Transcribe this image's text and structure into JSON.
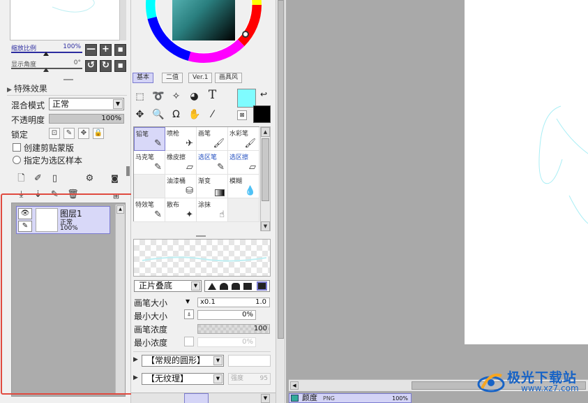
{
  "navigator": {
    "zoom_label": "缩放比例",
    "zoom_value": "100%",
    "rotate_label": "显示角度",
    "rotate_value": "0°",
    "zoom_out": "—",
    "zoom_in": "+",
    "zoom_reset": "■",
    "rotate_left": "↺",
    "rotate_right": "↻",
    "rotate_reset": "■"
  },
  "effects": {
    "header": "特殊效果"
  },
  "layer_props": {
    "blend_label": "混合模式",
    "blend_value": "正常",
    "opacity_label": "不透明度",
    "opacity_value": "100%",
    "lock_label": "锁定",
    "clip_label": "创建剪贴蒙版",
    "select_source_label": "指定为选区样本"
  },
  "layers": [
    {
      "name": "图层1",
      "mode": "正常",
      "opacity": "100%"
    }
  ],
  "color_tabs": [
    "基本",
    "二值",
    "Ver.1",
    "画具风"
  ],
  "colors": {
    "main": "#7ffcff",
    "sub": "#000000",
    "highlight": "#e04a3f"
  },
  "tools_icons": [
    "select-rect-icon",
    "lasso-icon",
    "magic-wand-icon",
    "select-pen-icon",
    "text-icon",
    "move-icon",
    "zoom-icon",
    "rotate-icon",
    "hand-icon",
    "eyedropper-icon"
  ],
  "brushes": [
    {
      "name": "铅笔",
      "icon": "✎",
      "selected": true,
      "blue": false
    },
    {
      "name": "喷枪",
      "icon": "✈",
      "selected": false,
      "blue": false
    },
    {
      "name": "画笔",
      "icon": "🖌",
      "selected": false,
      "blue": false
    },
    {
      "name": "水彩笔",
      "icon": "🖌",
      "selected": false,
      "blue": false
    },
    {
      "name": "马克笔",
      "icon": "✎",
      "selected": false,
      "blue": false
    },
    {
      "name": "橡皮擦",
      "icon": "▱",
      "selected": false,
      "blue": false
    },
    {
      "name": "选区笔",
      "icon": "✎",
      "selected": false,
      "blue": true
    },
    {
      "name": "选区擦",
      "icon": "▱",
      "selected": false,
      "blue": true
    },
    {
      "name": "",
      "icon": "",
      "selected": false,
      "blue": false
    },
    {
      "name": "油漆桶",
      "icon": "⛁",
      "selected": false,
      "blue": false
    },
    {
      "name": "渐变",
      "icon": "▭",
      "selected": false,
      "blue": false
    },
    {
      "name": "模糊",
      "icon": "💧",
      "selected": false,
      "blue": false
    },
    {
      "name": "特效笔",
      "icon": "✎",
      "selected": false,
      "blue": false
    },
    {
      "name": "散布",
      "icon": "✦",
      "selected": false,
      "blue": false
    },
    {
      "name": "涂抹",
      "icon": "☝",
      "selected": false,
      "blue": false
    },
    {
      "name": "",
      "icon": "",
      "selected": false,
      "blue": false
    }
  ],
  "brush_settings": {
    "edge_mode": "正片叠底",
    "size_label": "画笔大小",
    "size_multiplier": "x0.1",
    "size_value": "1.0",
    "min_size_label": "最小大小",
    "min_size_value": "0%",
    "density_label": "画笔浓度",
    "density_value": "100",
    "min_density_label": "最小浓度",
    "min_density_value": "0%",
    "shape_select": "【常规的圆形】",
    "texture_select": "【无纹理】",
    "texture_strength": "强度",
    "texture_strength_value": "95"
  },
  "file_tab": {
    "name": "颜度",
    "ext": "PNG",
    "zoom": "100%"
  },
  "watermark": {
    "title": "极光下载站",
    "url": "www.xz7.com"
  }
}
